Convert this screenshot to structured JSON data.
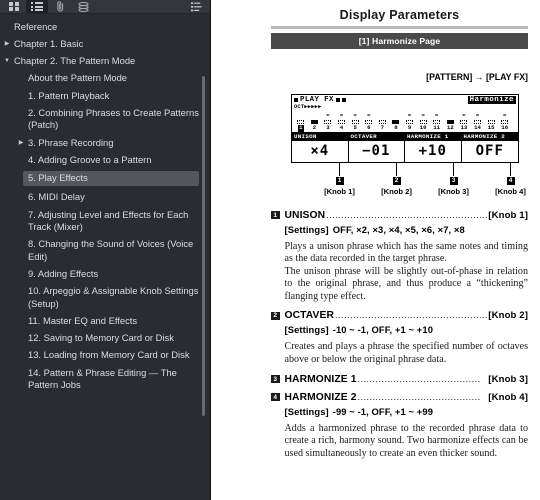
{
  "sidebar": {
    "toolbar": {
      "buttons": [
        {
          "name": "thumbnails-view-icon",
          "active": false
        },
        {
          "name": "outline-view-icon",
          "active": true
        },
        {
          "name": "attachments-icon",
          "active": false
        },
        {
          "name": "layers-icon",
          "active": false
        },
        {
          "name": "bookmarks-list-icon",
          "active": false
        }
      ]
    },
    "items": [
      {
        "label": "Reference",
        "indent": 0,
        "twisty": "",
        "selected": false
      },
      {
        "label": "Chapter 1. Basic",
        "indent": 0,
        "twisty": "▶",
        "selected": false
      },
      {
        "label": "Chapter 2. The Pattern Mode",
        "indent": 0,
        "twisty": "▼",
        "selected": false
      },
      {
        "label": "About the Pattern Mode",
        "indent": 1,
        "twisty": "",
        "selected": false
      },
      {
        "label": "1. Pattern Playback",
        "indent": 1,
        "twisty": "",
        "selected": false
      },
      {
        "label": "2. Combining Phrases to Create Patterns (Patch)",
        "indent": 1,
        "twisty": "",
        "selected": false
      },
      {
        "label": "3. Phrase Recording",
        "indent": 1,
        "twisty": "▶",
        "selected": false
      },
      {
        "label": "4. Adding Groove to a Pattern",
        "indent": 1,
        "twisty": "",
        "selected": false
      },
      {
        "label": "5. Play Effects",
        "indent": 1,
        "twisty": "",
        "selected": true
      },
      {
        "label": "6. MIDI Delay",
        "indent": 1,
        "twisty": "",
        "selected": false
      },
      {
        "label": "7. Adjusting Level and Effects for Each Track (Mixer)",
        "indent": 1,
        "twisty": "",
        "selected": false
      },
      {
        "label": "8. Changing the Sound of Voices (Voice Edit)",
        "indent": 1,
        "twisty": "",
        "selected": false
      },
      {
        "label": "9. Adding Effects",
        "indent": 1,
        "twisty": "",
        "selected": false
      },
      {
        "label": "10. Arpeggio & Assignable Knob Settings (Setup)",
        "indent": 1,
        "twisty": "",
        "selected": false
      },
      {
        "label": "11. Master EQ and Effects",
        "indent": 1,
        "twisty": "",
        "selected": false
      },
      {
        "label": "12. Saving to Memory Card or Disk",
        "indent": 1,
        "twisty": "",
        "selected": false
      },
      {
        "label": "13. Loading from Memory Card or Disk",
        "indent": 1,
        "twisty": "",
        "selected": false
      },
      {
        "label": "14. Pattern & Phrase Editing — The Pattern Jobs",
        "indent": 1,
        "twisty": "",
        "selected": false
      }
    ]
  },
  "document": {
    "title": "Display Parameters",
    "section_bar": "[1] Harmonize Page",
    "path": "[PATTERN] → [PLAY FX]",
    "lcd": {
      "header_left": "PLAY FX",
      "header_right": "Harmonize",
      "oct_label": "OCT▶▶▶▶▶",
      "steps": [
        {
          "num": "1",
          "z": false,
          "on": false,
          "highlight": true
        },
        {
          "num": "2",
          "z": false,
          "on": true,
          "highlight": false
        },
        {
          "num": "3",
          "z": true,
          "on": false,
          "highlight": false
        },
        {
          "num": "4",
          "z": true,
          "on": false,
          "highlight": false
        },
        {
          "num": "5",
          "z": true,
          "on": false,
          "highlight": false
        },
        {
          "num": "6",
          "z": true,
          "on": false,
          "highlight": false
        },
        {
          "num": "7",
          "z": false,
          "on": false,
          "highlight": false
        },
        {
          "num": "8",
          "z": false,
          "on": true,
          "highlight": false
        },
        {
          "num": "9",
          "z": true,
          "on": false,
          "highlight": false
        },
        {
          "num": "10",
          "z": true,
          "on": false,
          "highlight": false
        },
        {
          "num": "11",
          "z": true,
          "on": false,
          "highlight": false
        },
        {
          "num": "12",
          "z": false,
          "on": true,
          "highlight": false
        },
        {
          "num": "13",
          "z": true,
          "on": false,
          "highlight": false
        },
        {
          "num": "14",
          "z": true,
          "on": false,
          "highlight": false
        },
        {
          "num": "15",
          "z": false,
          "on": false,
          "highlight": false
        },
        {
          "num": "16",
          "z": true,
          "on": false,
          "highlight": false
        }
      ],
      "params": [
        {
          "name": "UNISON",
          "value": "×4"
        },
        {
          "name": "OCTAVER",
          "value": "−01"
        },
        {
          "name": "HARMONIZE 1",
          "value": "+10"
        },
        {
          "name": "HARMONIZE 2",
          "value": "OFF"
        }
      ]
    },
    "knobs": [
      {
        "badge": "1",
        "label": "[Knob 1]"
      },
      {
        "badge": "2",
        "label": "[Knob 2]"
      },
      {
        "badge": "3",
        "label": "[Knob 3]"
      },
      {
        "badge": "4",
        "label": "[Knob 4]"
      }
    ],
    "entries": [
      {
        "badge": "1",
        "name": "UNISON",
        "dots": "................................................................",
        "knobref": "[Knob 1]",
        "settings_label": "[Settings]",
        "settings_value": "OFF,  ×2, ×3, ×4, ×5, ×6, ×7, ×8",
        "body": "Plays a unison phrase which has the same notes and timing as the data recorded in the target phrase.\nThe unison phrase will be slightly out-of-phase in relation to the original phrase, and thus produce a “thickening” flanging type effect."
      },
      {
        "badge": "2",
        "name": "OCTAVER",
        "dots": "...............................................................",
        "knobref": "[Knob 2]",
        "settings_label": "[Settings]",
        "settings_value": "-10 ~ -1, OFF, +1 ~ +10",
        "body": "Creates and plays a phrase the specified number of octaves above or below the original phrase data."
      },
      {
        "badge": "3",
        "name": "HARMONIZE 1",
        "dots": ".........................................",
        "knobref": "[Knob 3]",
        "settings_label": "",
        "settings_value": "",
        "body": ""
      },
      {
        "badge": "4",
        "name": "HARMONIZE 2",
        "dots": ".........................................",
        "knobref": "[Knob 4]",
        "settings_label": "[Settings]",
        "settings_value": "-99 ~ -1, OFF, +1 ~ +99",
        "body": "Adds a harmonized phrase to the recorded phrase data to create a rich, harmony sound. Two harmonize effects can be used simultaneously to create an even thicker sound."
      }
    ]
  }
}
